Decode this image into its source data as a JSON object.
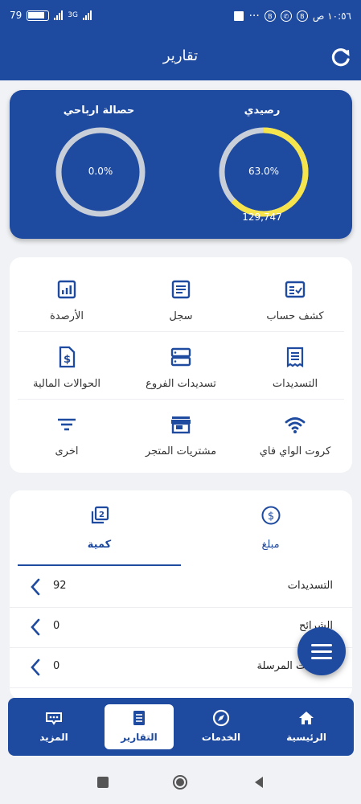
{
  "status_bar": {
    "battery": "79",
    "network_label": "3G",
    "time": "١٠:٥٦ ص"
  },
  "header": {
    "title": "تقارير"
  },
  "balances": [
    {
      "label": "رصيدي",
      "percent_text": "63.0%",
      "percent": 63.0,
      "value": "129,747",
      "color": "#f5e44b"
    },
    {
      "label": "حصالة ارباحي",
      "percent_text": "0.0%",
      "percent": 0.0,
      "value": "",
      "color": "#f5e44b"
    }
  ],
  "menu": {
    "items": [
      {
        "label": "كشف حساب",
        "icon": "account-statement-icon"
      },
      {
        "label": "سجل",
        "icon": "log-icon"
      },
      {
        "label": "الأرصدة",
        "icon": "balances-chart-icon"
      },
      {
        "label": "التسديدات",
        "icon": "payments-receipt-icon"
      },
      {
        "label": "تسديدات الفروع",
        "icon": "branch-payments-icon"
      },
      {
        "label": "الحوالات المالية",
        "icon": "money-transfer-icon"
      },
      {
        "label": "كروت الواي فاي",
        "icon": "wifi-icon"
      },
      {
        "label": "مشتريات المتجر",
        "icon": "store-icon"
      },
      {
        "label": "اخرى",
        "icon": "filter-icon"
      }
    ]
  },
  "stats": {
    "tabs": [
      {
        "label": "مبلغ",
        "icon": "dollar-icon"
      },
      {
        "label": "كمية",
        "icon": "quantity-icon"
      }
    ],
    "rows": [
      {
        "label": "التسديدات",
        "value": "92"
      },
      {
        "label": "الشرائح",
        "value": "0"
      },
      {
        "label": "الحوالات المرسلة",
        "value": "0"
      }
    ]
  },
  "bottom_nav": [
    {
      "label": "الرئيسية",
      "icon": "home-icon"
    },
    {
      "label": "الخدمات",
      "icon": "compass-icon"
    },
    {
      "label": "التقارير",
      "icon": "reports-icon"
    },
    {
      "label": "المزيد",
      "icon": "more-icon"
    }
  ],
  "colors": {
    "primary": "#1e4aa0",
    "accent": "#f5e44b",
    "track": "#c9cfd9"
  }
}
